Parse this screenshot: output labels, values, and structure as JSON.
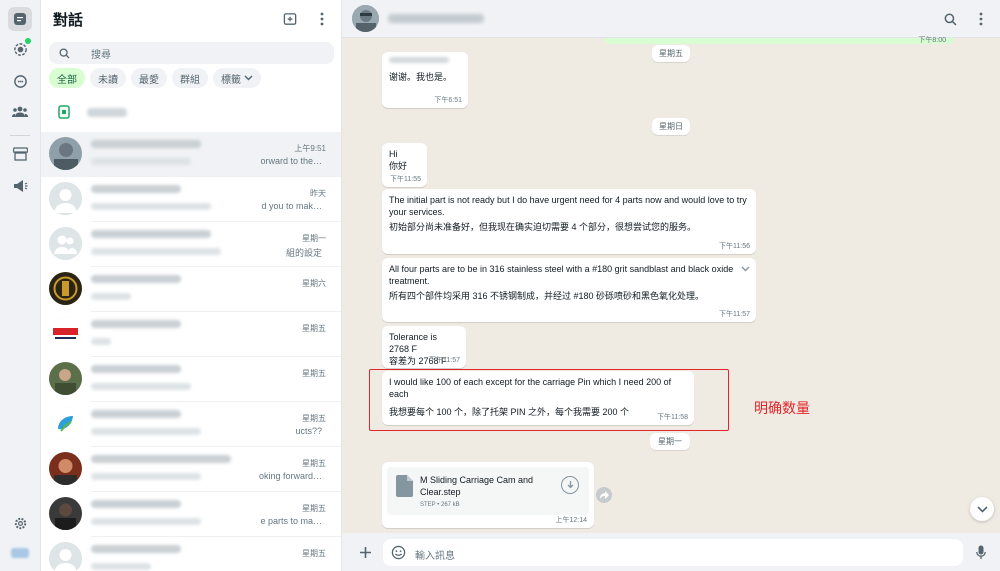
{
  "sidebar": {
    "title": "對話",
    "search_placeholder": "搜尋",
    "filters": [
      {
        "label": "全部",
        "active": true
      },
      {
        "label": "未讀",
        "active": false
      },
      {
        "label": "最愛",
        "active": false
      },
      {
        "label": "群組",
        "active": false
      },
      {
        "label": "標籤",
        "active": false
      }
    ],
    "chats": [
      {
        "time": "上午9:51",
        "snippet": "orward to the…",
        "name_w": 110,
        "msg_w": 100,
        "avatar": "photo1",
        "selected": true
      },
      {
        "time": "昨天",
        "snippet": "d you to mak…",
        "name_w": 90,
        "msg_w": 120,
        "avatar": "default"
      },
      {
        "time": "星期一",
        "snippet": "組的設定",
        "name_w": 120,
        "msg_w": 130,
        "avatar": "group"
      },
      {
        "time": "星期六",
        "snippet": "",
        "name_w": 90,
        "msg_w": 40,
        "avatar": "photo2"
      },
      {
        "time": "星期五",
        "snippet": "",
        "name_w": 90,
        "msg_w": 20,
        "avatar": "swiss"
      },
      {
        "time": "星期五",
        "snippet": "",
        "name_w": 90,
        "msg_w": 100,
        "avatar": "photo3"
      },
      {
        "time": "星期五",
        "snippet": "ucts??",
        "name_w": 90,
        "msg_w": 110,
        "avatar": "leaf"
      },
      {
        "time": "星期五",
        "snippet": "oking forward…",
        "name_w": 140,
        "msg_w": 110,
        "avatar": "photo4"
      },
      {
        "time": "星期五",
        "snippet": "e parts to ma…",
        "name_w": 90,
        "msg_w": 110,
        "avatar": "photo5"
      },
      {
        "time": "星期五",
        "snippet": "",
        "name_w": 90,
        "msg_w": 60,
        "avatar": "default"
      }
    ]
  },
  "conversation": {
    "composer_placeholder": "輸入訊息",
    "top_time": "下午8:00",
    "day_labels": [
      "星期五",
      "星期日",
      "星期一"
    ],
    "messages": [
      {
        "text": "谢谢。我也是。",
        "time": "下午6:51"
      },
      {
        "text": "Hi",
        "zh": "你好",
        "time": "下午11:55"
      },
      {
        "text": "The initial part is not ready but I do have urgent need for 4 parts now and would love to try your services.",
        "zh": "初始部分尚未准备好，但我现在确实迫切需要 4 个部分，很想尝试您的服务。",
        "time": "下午11:56"
      },
      {
        "text": "All four parts are to be in 316 stainless steel with a #180 grit sandblast and black oxide treatment.",
        "zh": "所有四个部件均采用 316 不锈钢制成，并经过 #180 砂砾喷砂和黑色氧化处理。",
        "time": "下午11:57"
      },
      {
        "text": "Tolerance is 2768 F",
        "zh": "容差为 2768 F",
        "time": "下午11:57"
      },
      {
        "text": "I would like 100 of each except for the  carriage Pin which I need 200 of each",
        "zh": "我想要每个 100 个，除了托架 PIN 之外，每个我需要 200 个",
        "time": "下午11:58"
      }
    ],
    "file": {
      "name": "M Sliding Carriage Cam and Clear.step",
      "meta": "STEP • 267 kB",
      "time": "上午12:14"
    },
    "annotation": "明确数量"
  }
}
